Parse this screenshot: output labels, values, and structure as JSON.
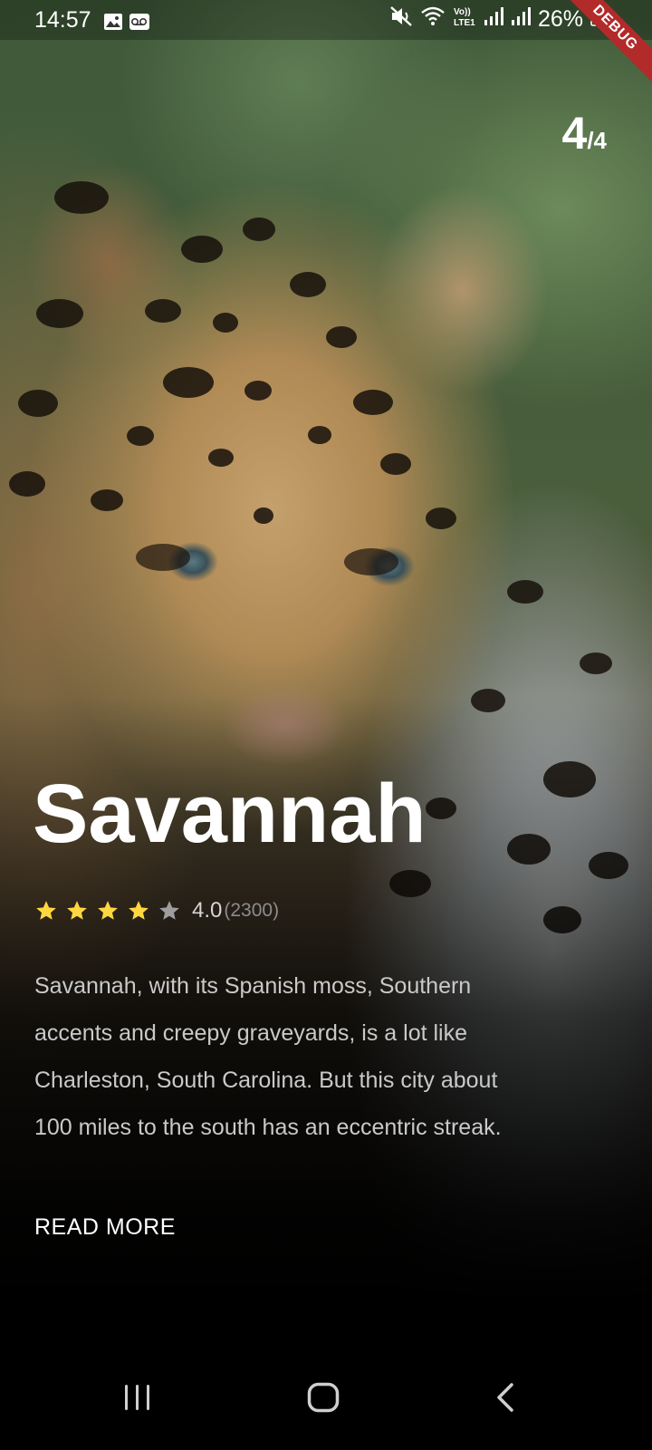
{
  "status_bar": {
    "time": "14:57",
    "battery": "26%",
    "icons": [
      "image-icon",
      "voicemail-icon",
      "mute-icon",
      "wifi-icon",
      "volte-icon",
      "signal-icon",
      "signal-icon",
      "battery-icon"
    ],
    "volte_label": "Vo))\nLTE1"
  },
  "debug_banner": "DEBUG",
  "counter": {
    "current": "4",
    "total": "/4"
  },
  "place": {
    "title": "Savannah",
    "rating": 4.0,
    "rating_value": "4.0",
    "rating_count": "(2300)",
    "description": "Savannah, with its Spanish moss, Southern accents and creepy graveyards, is a lot like Charleston, South Carolina. But this city about 100 miles to the south has an eccentric streak.",
    "read_more": "READ MORE"
  },
  "colors": {
    "star_filled": "#FFD740",
    "star_empty": "#9E9E9E",
    "debug_ribbon": "#B22A2A"
  },
  "navbar": {
    "buttons": [
      "recent-apps-icon",
      "home-icon",
      "back-icon"
    ]
  }
}
